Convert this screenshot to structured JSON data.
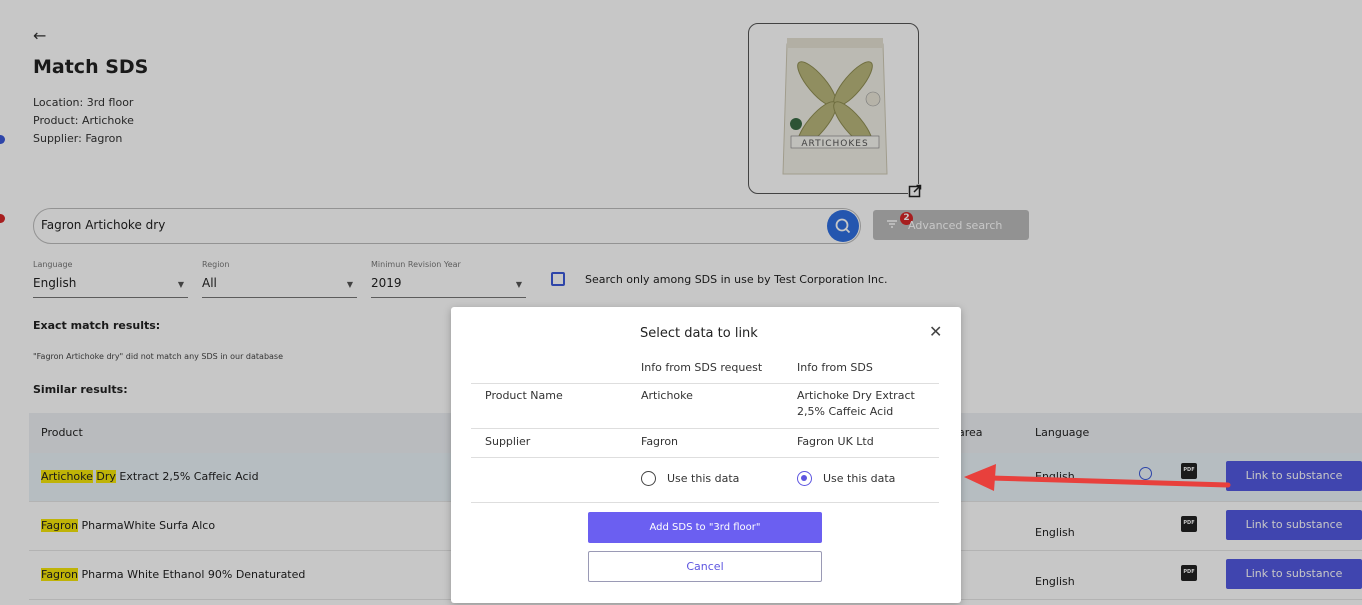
{
  "header": {
    "back_icon": "arrow-left-icon",
    "title": "Match SDS",
    "location": "Location: 3rd floor",
    "product": "Product: Artichoke",
    "supplier": "Supplier: Fagron"
  },
  "photo": {
    "brand_text": "ARTICHOKES",
    "open_icon": "external-link-icon"
  },
  "search": {
    "value": "Fagron Artichoke dry",
    "search_icon": "search-icon",
    "advanced_label": "Advanced search",
    "advanced_badge": "2",
    "filter_icon": "filter-icon"
  },
  "filters": {
    "language_label": "Language",
    "language_value": "English",
    "region_label": "Region",
    "region_value": "All",
    "year_label": "Minimun Revision Year",
    "year_value": "2019",
    "checkbox_label": "Search only among SDS in use by Test Corporation Inc.",
    "checkbox_checked": false
  },
  "results": {
    "exact_title": "Exact match results:",
    "exact_note": "\"Fagron Artichoke dry\" did not match any SDS in our database",
    "similar_title": "Similar results:",
    "columns": {
      "product": "Product",
      "area": "area",
      "language": "Language"
    },
    "rows": [
      {
        "pre": "",
        "mark1": "Artichoke",
        "mid": " ",
        "mark2": "Dry",
        "post": " Extract 2,5% Caffeic Acid",
        "language": "English",
        "link": "Link to substance"
      },
      {
        "pre": "",
        "mark1": "Fagron",
        "mid": "",
        "mark2": "",
        "post": " PharmaWhite Surfa Alco",
        "language": "English",
        "link": "Link to substance"
      },
      {
        "pre": "",
        "mark1": "Fagron",
        "mid": "",
        "mark2": "",
        "post": " Pharma White Ethanol 90% Denaturated",
        "language": "English",
        "link": "Link to substance"
      }
    ],
    "pdf_icon_text": "PDF"
  },
  "modal": {
    "title": "Select data to link",
    "close_icon": "close-icon",
    "col_request": "Info from SDS request",
    "col_sds": "Info from SDS",
    "rows": [
      {
        "label": "Product Name",
        "request": "Artichoke",
        "sds_line1": "Artichoke Dry Extract",
        "sds_line2": "2,5% Caffeic Acid"
      },
      {
        "label": "Supplier",
        "request": "Fagron",
        "sds_line1": "Fagron UK Ltd",
        "sds_line2": ""
      }
    ],
    "use_request_label": "Use this data",
    "use_sds_label": "Use this data",
    "selected": "sds",
    "add_button": "Add SDS to \"3rd floor\"",
    "cancel_button": "Cancel"
  },
  "colors": {
    "accent": "#5359e0",
    "search_blue": "#2f6fe0",
    "highlight": "#f5e60a",
    "arrow": "#e8403c"
  }
}
